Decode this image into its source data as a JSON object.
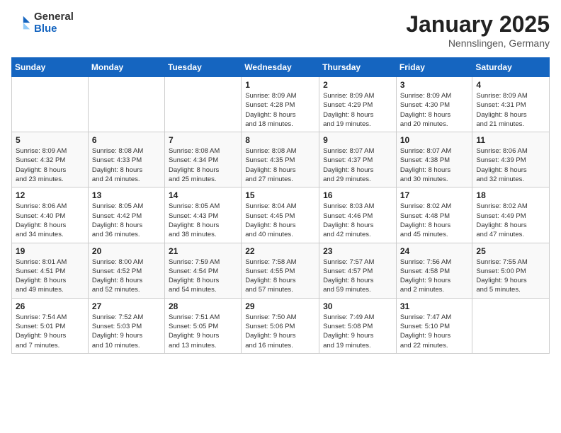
{
  "logo": {
    "general": "General",
    "blue": "Blue"
  },
  "header": {
    "month": "January 2025",
    "location": "Nennslingen, Germany"
  },
  "weekdays": [
    "Sunday",
    "Monday",
    "Tuesday",
    "Wednesday",
    "Thursday",
    "Friday",
    "Saturday"
  ],
  "rows": [
    [
      {
        "day": "",
        "info": ""
      },
      {
        "day": "",
        "info": ""
      },
      {
        "day": "",
        "info": ""
      },
      {
        "day": "1",
        "info": "Sunrise: 8:09 AM\nSunset: 4:28 PM\nDaylight: 8 hours\nand 18 minutes."
      },
      {
        "day": "2",
        "info": "Sunrise: 8:09 AM\nSunset: 4:29 PM\nDaylight: 8 hours\nand 19 minutes."
      },
      {
        "day": "3",
        "info": "Sunrise: 8:09 AM\nSunset: 4:30 PM\nDaylight: 8 hours\nand 20 minutes."
      },
      {
        "day": "4",
        "info": "Sunrise: 8:09 AM\nSunset: 4:31 PM\nDaylight: 8 hours\nand 21 minutes."
      }
    ],
    [
      {
        "day": "5",
        "info": "Sunrise: 8:09 AM\nSunset: 4:32 PM\nDaylight: 8 hours\nand 23 minutes."
      },
      {
        "day": "6",
        "info": "Sunrise: 8:08 AM\nSunset: 4:33 PM\nDaylight: 8 hours\nand 24 minutes."
      },
      {
        "day": "7",
        "info": "Sunrise: 8:08 AM\nSunset: 4:34 PM\nDaylight: 8 hours\nand 25 minutes."
      },
      {
        "day": "8",
        "info": "Sunrise: 8:08 AM\nSunset: 4:35 PM\nDaylight: 8 hours\nand 27 minutes."
      },
      {
        "day": "9",
        "info": "Sunrise: 8:07 AM\nSunset: 4:37 PM\nDaylight: 8 hours\nand 29 minutes."
      },
      {
        "day": "10",
        "info": "Sunrise: 8:07 AM\nSunset: 4:38 PM\nDaylight: 8 hours\nand 30 minutes."
      },
      {
        "day": "11",
        "info": "Sunrise: 8:06 AM\nSunset: 4:39 PM\nDaylight: 8 hours\nand 32 minutes."
      }
    ],
    [
      {
        "day": "12",
        "info": "Sunrise: 8:06 AM\nSunset: 4:40 PM\nDaylight: 8 hours\nand 34 minutes."
      },
      {
        "day": "13",
        "info": "Sunrise: 8:05 AM\nSunset: 4:42 PM\nDaylight: 8 hours\nand 36 minutes."
      },
      {
        "day": "14",
        "info": "Sunrise: 8:05 AM\nSunset: 4:43 PM\nDaylight: 8 hours\nand 38 minutes."
      },
      {
        "day": "15",
        "info": "Sunrise: 8:04 AM\nSunset: 4:45 PM\nDaylight: 8 hours\nand 40 minutes."
      },
      {
        "day": "16",
        "info": "Sunrise: 8:03 AM\nSunset: 4:46 PM\nDaylight: 8 hours\nand 42 minutes."
      },
      {
        "day": "17",
        "info": "Sunrise: 8:02 AM\nSunset: 4:48 PM\nDaylight: 8 hours\nand 45 minutes."
      },
      {
        "day": "18",
        "info": "Sunrise: 8:02 AM\nSunset: 4:49 PM\nDaylight: 8 hours\nand 47 minutes."
      }
    ],
    [
      {
        "day": "19",
        "info": "Sunrise: 8:01 AM\nSunset: 4:51 PM\nDaylight: 8 hours\nand 49 minutes."
      },
      {
        "day": "20",
        "info": "Sunrise: 8:00 AM\nSunset: 4:52 PM\nDaylight: 8 hours\nand 52 minutes."
      },
      {
        "day": "21",
        "info": "Sunrise: 7:59 AM\nSunset: 4:54 PM\nDaylight: 8 hours\nand 54 minutes."
      },
      {
        "day": "22",
        "info": "Sunrise: 7:58 AM\nSunset: 4:55 PM\nDaylight: 8 hours\nand 57 minutes."
      },
      {
        "day": "23",
        "info": "Sunrise: 7:57 AM\nSunset: 4:57 PM\nDaylight: 8 hours\nand 59 minutes."
      },
      {
        "day": "24",
        "info": "Sunrise: 7:56 AM\nSunset: 4:58 PM\nDaylight: 9 hours\nand 2 minutes."
      },
      {
        "day": "25",
        "info": "Sunrise: 7:55 AM\nSunset: 5:00 PM\nDaylight: 9 hours\nand 5 minutes."
      }
    ],
    [
      {
        "day": "26",
        "info": "Sunrise: 7:54 AM\nSunset: 5:01 PM\nDaylight: 9 hours\nand 7 minutes."
      },
      {
        "day": "27",
        "info": "Sunrise: 7:52 AM\nSunset: 5:03 PM\nDaylight: 9 hours\nand 10 minutes."
      },
      {
        "day": "28",
        "info": "Sunrise: 7:51 AM\nSunset: 5:05 PM\nDaylight: 9 hours\nand 13 minutes."
      },
      {
        "day": "29",
        "info": "Sunrise: 7:50 AM\nSunset: 5:06 PM\nDaylight: 9 hours\nand 16 minutes."
      },
      {
        "day": "30",
        "info": "Sunrise: 7:49 AM\nSunset: 5:08 PM\nDaylight: 9 hours\nand 19 minutes."
      },
      {
        "day": "31",
        "info": "Sunrise: 7:47 AM\nSunset: 5:10 PM\nDaylight: 9 hours\nand 22 minutes."
      },
      {
        "day": "",
        "info": ""
      }
    ]
  ]
}
